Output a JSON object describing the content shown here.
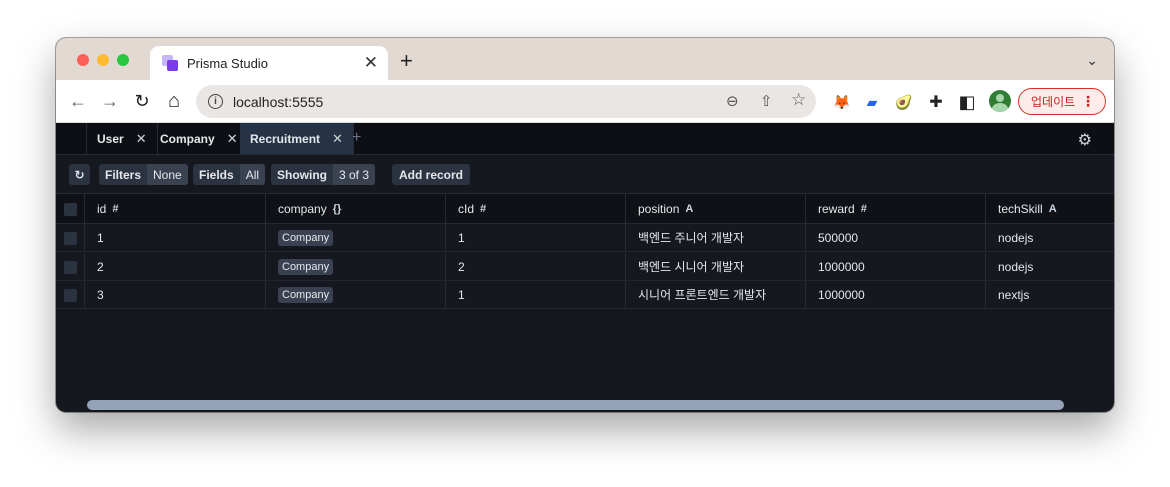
{
  "browser": {
    "tab_title": "Prisma Studio",
    "tab_close": "✕",
    "new_tab": "+",
    "tab_menu": "⌄",
    "url": "localhost:5555",
    "update_label": "업데이트",
    "menu_dots": "⋮",
    "back": "←",
    "forward": "→",
    "reload": "↻",
    "home": "⌂",
    "info": "i",
    "zoom": "⊖",
    "share": "⇧",
    "star": "☆",
    "ext_fox": "🦊",
    "ext_blue": "▰",
    "ext_avocado": "🥑",
    "ext_puzzle": "✚",
    "sidepanel": "◧"
  },
  "studio": {
    "tabs": [
      {
        "label": "User",
        "close": "✕"
      },
      {
        "label": "Company",
        "close": "✕"
      },
      {
        "label": "Recruitment",
        "close": "✕"
      }
    ],
    "add_tab": "+",
    "settings": "⚙",
    "actions": {
      "refresh": "↻",
      "filters_label": "Filters",
      "filters_value": "None",
      "fields_label": "Fields",
      "fields_value": "All",
      "showing_label": "Showing",
      "showing_value": "3 of 3",
      "add_record": "Add record"
    },
    "columns": [
      {
        "name": "id",
        "type": "#"
      },
      {
        "name": "company",
        "type": "{}"
      },
      {
        "name": "cId",
        "type": "#"
      },
      {
        "name": "position",
        "type": "A"
      },
      {
        "name": "reward",
        "type": "#"
      },
      {
        "name": "techSkill",
        "type": "A"
      }
    ],
    "rows": [
      {
        "id": "1",
        "company": "Company",
        "cId": "1",
        "position": "백엔드 주니어 개발자",
        "reward": "500000",
        "techSkill": "nodejs"
      },
      {
        "id": "2",
        "company": "Company",
        "cId": "2",
        "position": "백엔드 시니어 개발자",
        "reward": "1000000",
        "techSkill": "nodejs"
      },
      {
        "id": "3",
        "company": "Company",
        "cId": "1",
        "position": "시니어 프론트엔드 개발자",
        "reward": "1000000",
        "techSkill": "nextjs"
      }
    ]
  },
  "colors": {
    "titlebar": "#e3d9d3",
    "studio_bg": "#15181e",
    "active_tab": "#263246",
    "update_red": "#c5221f"
  }
}
